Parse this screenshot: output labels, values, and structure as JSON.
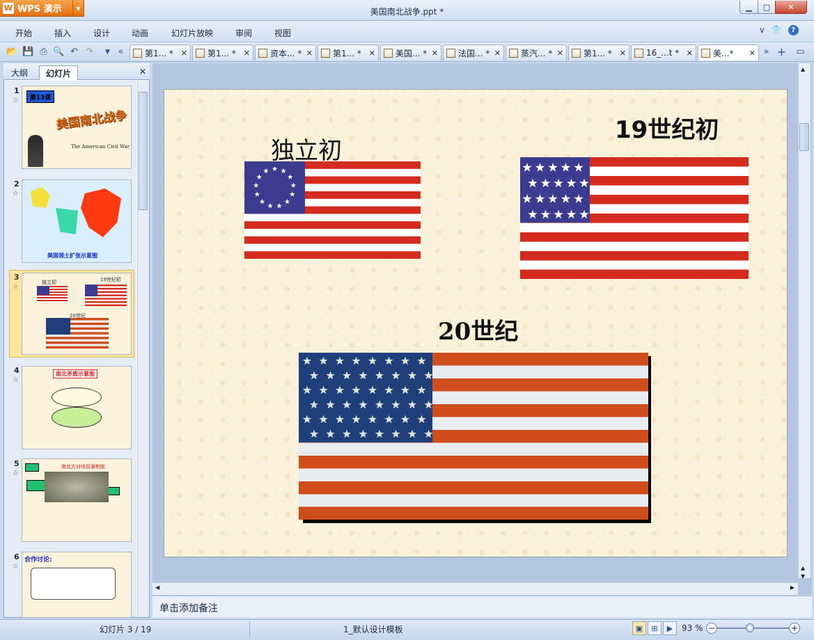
{
  "app": {
    "name": "WPS 演示",
    "window_title": "美国南北战争.ppt *"
  },
  "menu": [
    "开始",
    "插入",
    "设计",
    "动画",
    "幻灯片放映",
    "审阅",
    "视图"
  ],
  "menu_right": [
    "∨",
    "👕",
    "?"
  ],
  "doc_tabs": [
    "第1... *",
    "第1... *",
    "资本... *",
    "第1... *",
    "美国... *",
    "法国... *",
    "蒸汽... *",
    "第1... *",
    "16_...t *",
    "美...*"
  ],
  "pane": {
    "tab_outline": "大纲",
    "tab_slides": "幻灯片"
  },
  "thumbs": [
    {
      "num": "1",
      "caption": "美国南北战争",
      "sub": "The American Civil War",
      "badge": "第13课"
    },
    {
      "num": "2",
      "caption": "美国领土扩张示意图"
    },
    {
      "num": "3",
      "t1": "独立初",
      "t2": "19世纪初",
      "t3": "20世纪"
    },
    {
      "num": "4",
      "caption": "南北矛盾示意图"
    },
    {
      "num": "5",
      "caption": "南北方对待奴隶制度"
    },
    {
      "num": "6",
      "caption": "合作讨论:"
    }
  ],
  "slide": {
    "label_independence": "独立初",
    "label_19c": "19世纪初",
    "label_20c": "20世纪"
  },
  "notes": {
    "placeholder": "单击添加备注"
  },
  "status": {
    "slide": "幻灯片 3 / 19",
    "template": "1_默认设计模板",
    "zoom": "93 %"
  },
  "colors": {
    "flag_red": "#d52b1e",
    "flag_blue": "#3b3b8f",
    "flag_navy": "#1f3f7a",
    "flag_orange": "#cf4d1c"
  }
}
